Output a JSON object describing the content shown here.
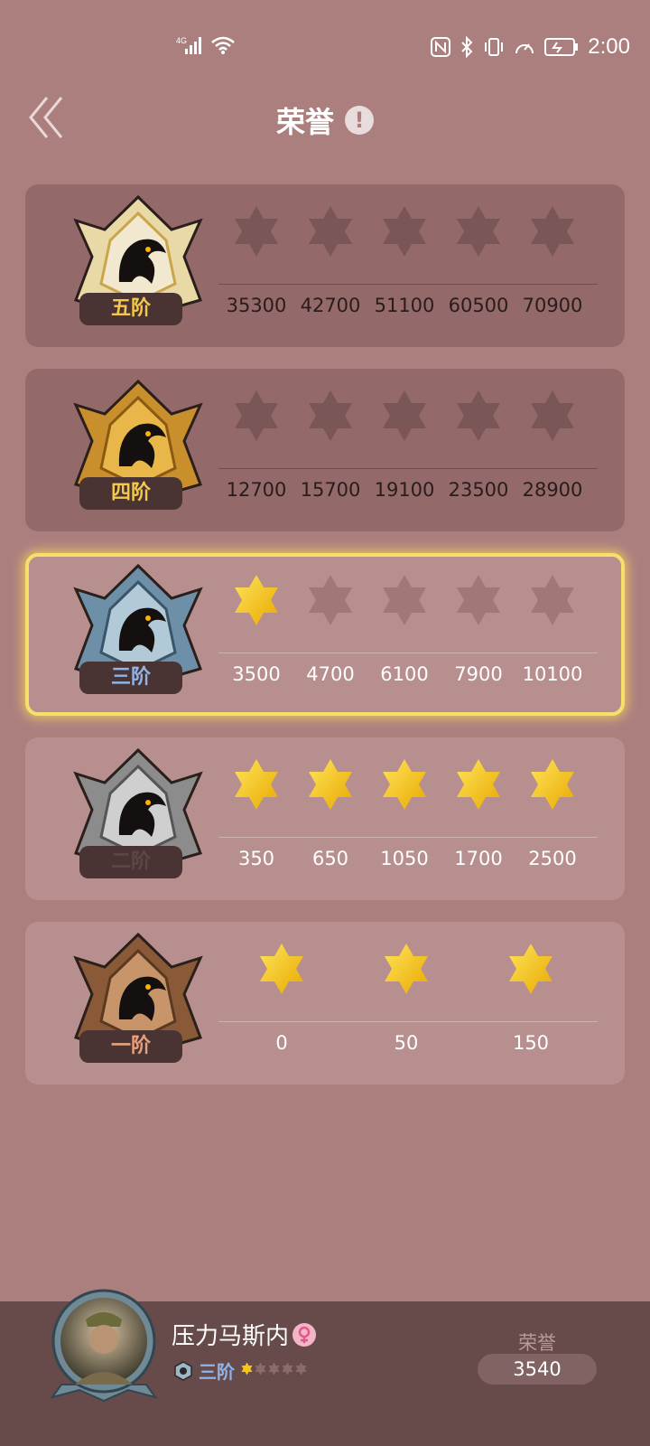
{
  "status_bar": {
    "network": "4G",
    "time": "2:00"
  },
  "header": {
    "title": "荣誉",
    "info_icon": "!"
  },
  "tiers": [
    {
      "label": "五阶",
      "state": "locked",
      "thresholds": [
        "35300",
        "42700",
        "51100",
        "60500",
        "70900"
      ],
      "stars_earned": 0
    },
    {
      "label": "四阶",
      "state": "locked",
      "thresholds": [
        "12700",
        "15700",
        "19100",
        "23500",
        "28900"
      ],
      "stars_earned": 0
    },
    {
      "label": "三阶",
      "state": "current",
      "thresholds": [
        "3500",
        "4700",
        "6100",
        "7900",
        "10100"
      ],
      "stars_earned": 1
    },
    {
      "label": "二阶",
      "state": "open",
      "thresholds": [
        "350",
        "650",
        "1050",
        "1700",
        "2500"
      ],
      "stars_earned": 5
    },
    {
      "label": "一阶",
      "state": "open",
      "thresholds": [
        "0",
        "50",
        "150"
      ],
      "stars_earned": 3
    }
  ],
  "profile": {
    "username": "压力马斯内",
    "rank": "三阶",
    "rank_stars_earned": 1,
    "rank_stars_total": 5,
    "honor_label": "荣誉",
    "honor_value": "3540"
  },
  "colors": {
    "background": "#ac7f7f",
    "card_locked": "#936969",
    "card_open": "#b88f8f",
    "star_gold": "#f5c414",
    "current_border": "#f7e06a",
    "footer": "#674a4a"
  }
}
